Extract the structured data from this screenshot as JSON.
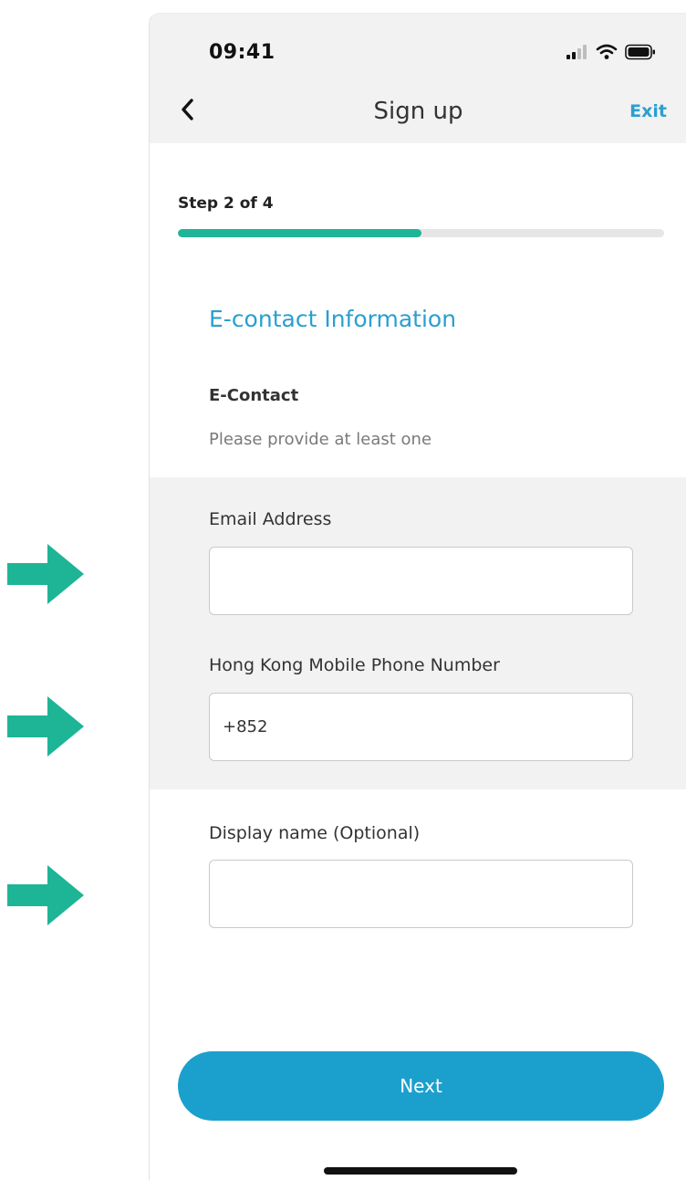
{
  "status_bar": {
    "time": "09:41",
    "signal_icon": "cellular-signal-icon",
    "wifi_icon": "wifi-icon",
    "battery_icon": "battery-icon"
  },
  "nav": {
    "back_icon": "chevron-left-icon",
    "title": "Sign up",
    "exit_label": "Exit"
  },
  "progress": {
    "step_label": "Step 2 of 4",
    "fraction": 0.5
  },
  "section": {
    "title": "E-contact Information",
    "group_label": "E-Contact",
    "helper_text": "Please provide at least one"
  },
  "fields": {
    "email": {
      "label": "Email Address",
      "value": ""
    },
    "phone": {
      "label": "Hong Kong Mobile Phone Number",
      "value": "+852"
    },
    "display_name": {
      "label": "Display name (Optional)",
      "value": ""
    }
  },
  "actions": {
    "next_label": "Next"
  },
  "colors": {
    "accent": "#1ba0cd",
    "progress": "#1eb596",
    "annotation_arrow": "#1eb596"
  }
}
